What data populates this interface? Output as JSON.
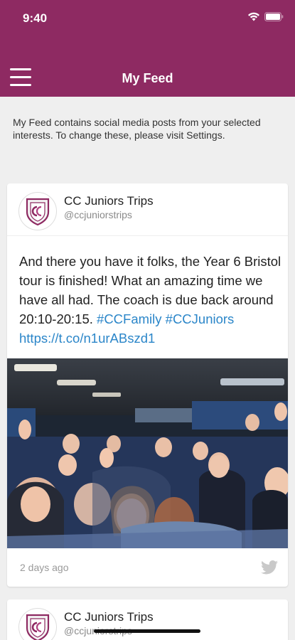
{
  "status": {
    "time": "9:40"
  },
  "header": {
    "title": "My Feed",
    "menu_icon": "hamburger-icon",
    "background": "#8e2a62"
  },
  "intro": "My Feed contains social media posts from your selected interests. To change these, please visit Settings.",
  "posts": [
    {
      "account_name": "CC Juniors Trips",
      "handle": "@ccjuniorstrips",
      "text": "And there you have it folks, the Year 6 Bristol tour is finished! What an amazing time we have all had. The coach is due back around 20:10-20:15. ",
      "hashtag1": "#CCFamily",
      "hashtag2": "#CCJuniors",
      "url": "https://t.co/n1urABszd1",
      "timestamp": "2 days ago",
      "source_icon": "twitter-icon",
      "link_color": "#2b86c9"
    },
    {
      "account_name": "CC Juniors Trips",
      "handle": "@ccjuniorstrips"
    }
  ]
}
